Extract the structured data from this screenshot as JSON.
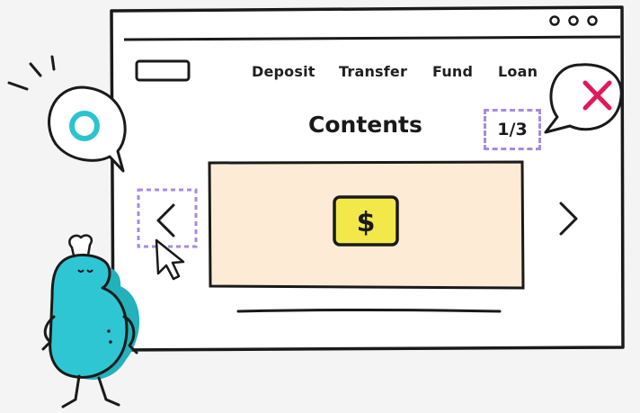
{
  "nav": {
    "items": [
      {
        "label": "Deposit"
      },
      {
        "label": "Transfer"
      },
      {
        "label": "Fund"
      },
      {
        "label": "Loan"
      }
    ]
  },
  "content": {
    "title": "Contents",
    "page_indicator": "1/3",
    "banner_symbol": "$"
  },
  "colors": {
    "background": "#f4f4f4",
    "banner_fill": "#fdebd6",
    "dollar_badge": "#f3e84a",
    "highlight_dashes": "#a78be0",
    "close_x": "#e0195a",
    "circle_o": "#29c4cf",
    "character": "#2fc6d3"
  },
  "icons": [
    "window-dots-icon",
    "logo-placeholder",
    "prev-arrow-icon",
    "next-arrow-icon",
    "cursor-icon",
    "dollar-icon",
    "close-x-icon",
    "circle-o-icon"
  ]
}
